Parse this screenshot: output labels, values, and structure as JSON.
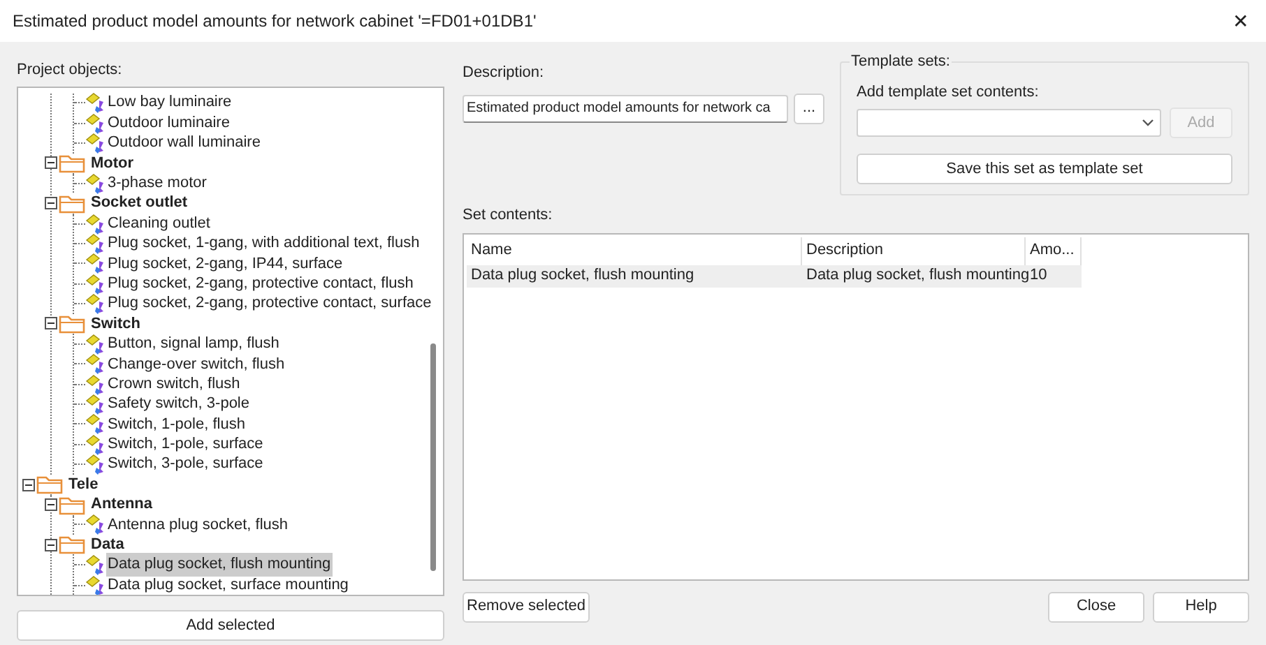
{
  "window": {
    "title": "Estimated product model amounts for network cabinet '=FD01+01DB1'",
    "close": "✕"
  },
  "project_objects": {
    "label": "Project objects:",
    "tree": [
      {
        "kind": "partial",
        "children": [
          {
            "kind": "partial",
            "children": [
              {
                "kind": "leaf",
                "label": "Low bay luminaire",
                "selected": false
              },
              {
                "kind": "leaf",
                "label": "Outdoor luminaire",
                "selected": false
              },
              {
                "kind": "leaf",
                "label": "Outdoor wall luminaire",
                "selected": false
              }
            ]
          },
          {
            "kind": "folder",
            "label": "Motor",
            "expanded": true,
            "children": [
              {
                "kind": "leaf",
                "label": "3-phase motor",
                "selected": false
              }
            ]
          },
          {
            "kind": "folder",
            "label": "Socket outlet",
            "expanded": true,
            "children": [
              {
                "kind": "leaf",
                "label": "Cleaning outlet",
                "selected": false
              },
              {
                "kind": "leaf",
                "label": "Plug socket, 1-gang, with additional text, flush",
                "selected": false
              },
              {
                "kind": "leaf",
                "label": "Plug socket, 2-gang, IP44, surface",
                "selected": false
              },
              {
                "kind": "leaf",
                "label": "Plug socket, 2-gang, protective contact, flush",
                "selected": false
              },
              {
                "kind": "leaf",
                "label": "Plug socket, 2-gang, protective contact, surface",
                "selected": false
              }
            ]
          },
          {
            "kind": "folder",
            "label": "Switch",
            "expanded": true,
            "children": [
              {
                "kind": "leaf",
                "label": "Button, signal lamp, flush",
                "selected": false
              },
              {
                "kind": "leaf",
                "label": "Change-over switch, flush",
                "selected": false
              },
              {
                "kind": "leaf",
                "label": "Crown switch, flush",
                "selected": false
              },
              {
                "kind": "leaf",
                "label": "Safety switch, 3-pole",
                "selected": false
              },
              {
                "kind": "leaf",
                "label": "Switch, 1-pole, flush",
                "selected": false
              },
              {
                "kind": "leaf",
                "label": "Switch, 1-pole, surface",
                "selected": false
              },
              {
                "kind": "leaf",
                "label": "Switch, 3-pole, surface",
                "selected": false
              }
            ]
          }
        ]
      },
      {
        "kind": "folder",
        "label": "Tele",
        "expanded": true,
        "children": [
          {
            "kind": "folder",
            "label": "Antenna",
            "expanded": true,
            "children": [
              {
                "kind": "leaf",
                "label": "Antenna plug socket, flush",
                "selected": false
              }
            ]
          },
          {
            "kind": "folder",
            "label": "Data",
            "expanded": true,
            "children": [
              {
                "kind": "leaf",
                "label": "Data plug socket, flush mounting",
                "selected": true
              },
              {
                "kind": "leaf",
                "label": "Data plug socket, surface mounting",
                "selected": false
              }
            ]
          }
        ]
      }
    ],
    "add_button": "Add selected"
  },
  "description": {
    "label": "Description:",
    "value": "Estimated product model amounts for network ca",
    "browse_button": "..."
  },
  "template_sets": {
    "title": "Template sets:",
    "add_label": "Add template set contents:",
    "add_button": "Add",
    "add_disabled": true,
    "save_button": "Save this set as template set"
  },
  "set_contents": {
    "label": "Set contents:",
    "columns": [
      "Name",
      "Description",
      "Amo..."
    ],
    "rows": [
      {
        "cells": [
          "Data plug socket, flush mounting",
          "Data plug socket, flush mounting",
          "10"
        ],
        "selected": true
      }
    ]
  },
  "remove_button": "Remove selected",
  "buttons": [
    "Close",
    "Help"
  ]
}
